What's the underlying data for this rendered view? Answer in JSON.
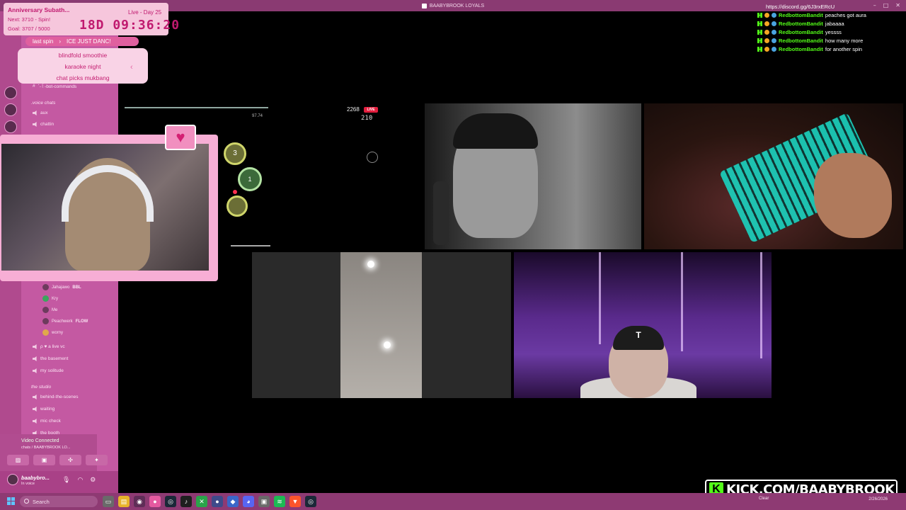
{
  "window": {
    "title": "BAABYBROOK LOYALS",
    "controls": [
      "–",
      "□",
      "✕"
    ]
  },
  "subathon": {
    "title": "Anniversary Subath...",
    "next": "Next: 3710 - Spin!",
    "goal": "Goal: 3707 / 5000",
    "live_day": "Live - Day 25",
    "timer": "18D 09:36:20"
  },
  "spin": {
    "label": "last spin",
    "last": "ICE JUST DANC!",
    "items": [
      "blindfold smoothie",
      "karaoke night",
      "chat picks mukbang"
    ]
  },
  "sidebar": {
    "channels_top": [
      {
        "name": "ˋ-꒰-bot-commands"
      }
    ],
    "voice_category": ".voice chats",
    "voice_channels": [
      {
        "name": "aux"
      },
      {
        "name": "chattin"
      }
    ],
    "members": [
      {
        "name": "Jahajawo",
        "tag": "BBL"
      },
      {
        "name": "Kry",
        "tag": ""
      },
      {
        "name": "Me",
        "tag": ""
      },
      {
        "name": "Peachwerk",
        "tag": "FLOW"
      },
      {
        "name": "worny",
        "tag": ""
      }
    ],
    "more_channels": [
      {
        "name": "ρ ♥ a live vc"
      },
      {
        "name": "the basement"
      },
      {
        "name": "my solitude"
      }
    ],
    "studio_category": "the studio",
    "studio_channels": [
      {
        "name": "behind-the-scenes"
      },
      {
        "name": "waiting"
      },
      {
        "name": "mic check"
      },
      {
        "name": "the booth"
      }
    ],
    "voice_connected": {
      "title": "Video Connected",
      "sub": "chats / BAABYBROOK LO..."
    },
    "user": {
      "name": "baabybro...",
      "status": "In voice"
    }
  },
  "osu": {
    "score": "2268",
    "live": "LIVE",
    "combo": "210",
    "left_stat": "",
    "right_stat": "97.74",
    "circles": [
      "3",
      "1"
    ]
  },
  "chat": {
    "link": "https://discord.gg/6J3rxERcU",
    "messages": [
      {
        "user": "RedbottomBandit",
        "text": "peaches got aura"
      },
      {
        "user": "RedbottomBandit",
        "text": "jabaaaa"
      },
      {
        "user": "RedbottomBandit",
        "text": "yessss"
      },
      {
        "user": "RedbottomBandit",
        "text": "how many more"
      },
      {
        "user": "RedbottomBandit",
        "text": "for another spin"
      }
    ]
  },
  "banner": {
    "text": "KICK.COM/BAABYBROOK",
    "k": "K"
  },
  "taskbar": {
    "search": "Search",
    "weather": "Clear",
    "date": "2/26/2026"
  },
  "colors": {
    "accent": "#c01a6f",
    "kick_green": "#53fc18",
    "sidebar": "#c459a2",
    "taskbar": "#8e3a73"
  }
}
